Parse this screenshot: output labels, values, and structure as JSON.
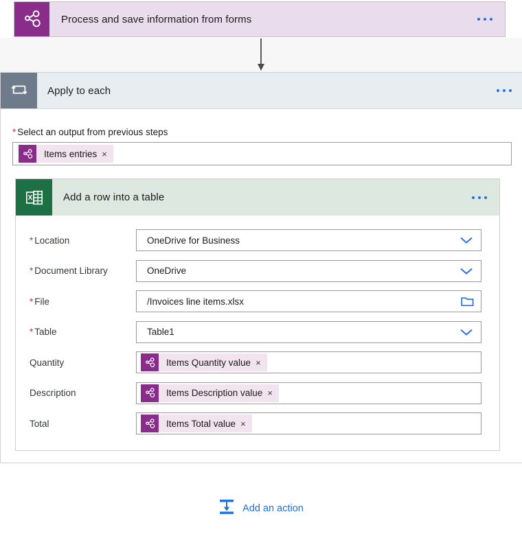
{
  "trigger": {
    "title": "Process and save information from forms",
    "icon": "forms-icon",
    "menu": "more-options"
  },
  "scope": {
    "title": "Apply to each",
    "icon": "loop-icon",
    "required_marker": "*",
    "input_label": "Select an output from previous steps",
    "token": {
      "text": "Items entries",
      "remove": "×",
      "icon": "forms-icon"
    }
  },
  "action": {
    "title": "Add a row into a table",
    "icon": "excel-icon",
    "fields": [
      {
        "label": "Location",
        "required": true,
        "value": "OneDrive for Business",
        "control": "dropdown",
        "type": "text"
      },
      {
        "label": "Document Library",
        "required": true,
        "value": "OneDrive",
        "control": "dropdown",
        "type": "text"
      },
      {
        "label": "File",
        "required": true,
        "value": "/Invoices line items.xlsx",
        "control": "folder",
        "type": "text"
      },
      {
        "label": "Table",
        "required": true,
        "value": "Table1",
        "control": "dropdown",
        "type": "text"
      },
      {
        "label": "Quantity",
        "required": false,
        "value": "Items Quantity value",
        "control": "none",
        "type": "token"
      },
      {
        "label": "Description",
        "required": false,
        "value": "Items Description value",
        "control": "none",
        "type": "token"
      },
      {
        "label": "Total",
        "required": false,
        "value": "Items Total value",
        "control": "none",
        "type": "token"
      }
    ],
    "token_remove": "×"
  },
  "footer": {
    "add_action_label": "Add an action",
    "add_action_icon": "insert-action-icon"
  },
  "colors": {
    "forms_purple": "#8a2d8a",
    "trigger_bg": "#e9dced",
    "scope_header_bg": "#e8edf1",
    "loop_gray": "#6e7b8b",
    "excel_green": "#1d7044",
    "excel_header_bg": "#dde9e0",
    "token_bg": "#f2e4ef",
    "link_blue": "#1f6fe0",
    "required_red": "#c4314b"
  }
}
